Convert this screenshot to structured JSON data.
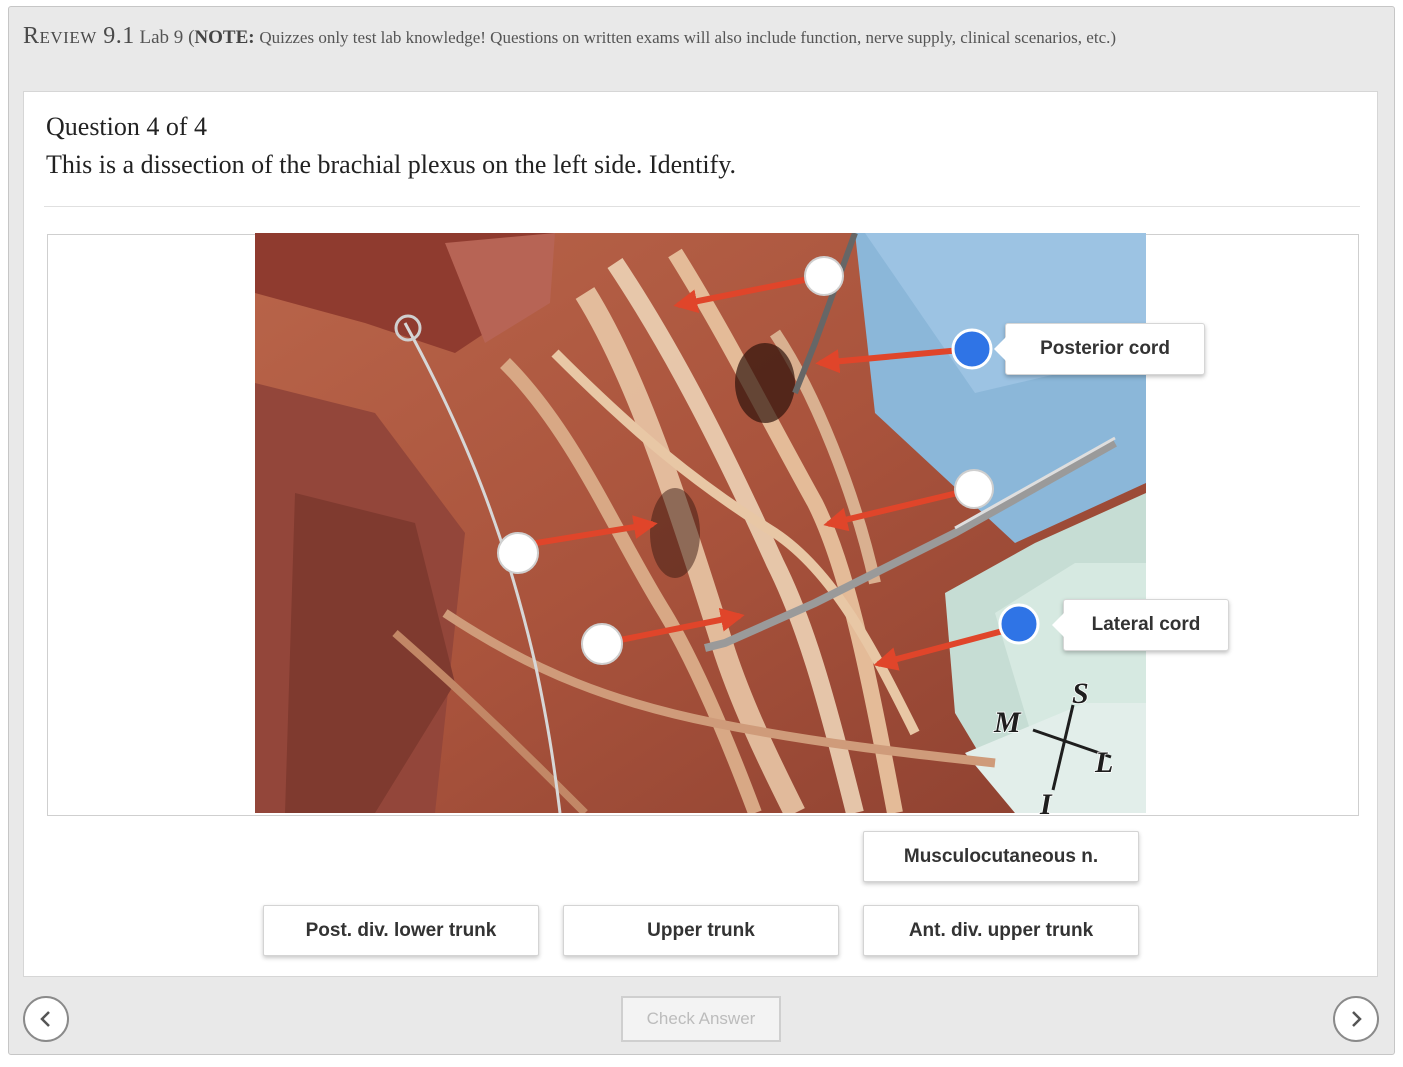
{
  "header": {
    "review": "Review 9.1",
    "lab": "Lab 9",
    "note_open": "(",
    "note_label": "NOTE:",
    "note_body": "Quizzes only test lab knowledge! Questions on written exams will also include function, nerve supply, clinical scenarios, etc.)"
  },
  "question": {
    "number": "Question 4 of 4",
    "text": "This is a dissection of the brachial plexus on the left side.  Identify."
  },
  "image": {
    "placed_labels": [
      "Posterior cord",
      "Lateral cord"
    ],
    "orientation": {
      "superior": "S",
      "inferior": "I",
      "medial": "M",
      "lateral": "L"
    },
    "colors": {
      "arrow": "#e0452a",
      "filled_marker": "#2f74e6",
      "empty_marker": "#ffffff"
    }
  },
  "options": [
    "Musculocutaneous n.",
    "Post. div. lower trunk",
    "Upper trunk",
    "Ant. div. upper trunk"
  ],
  "footer": {
    "check_answer": "Check Answer"
  },
  "icons": {
    "prev": "chevron-left-icon",
    "next": "chevron-right-icon"
  }
}
